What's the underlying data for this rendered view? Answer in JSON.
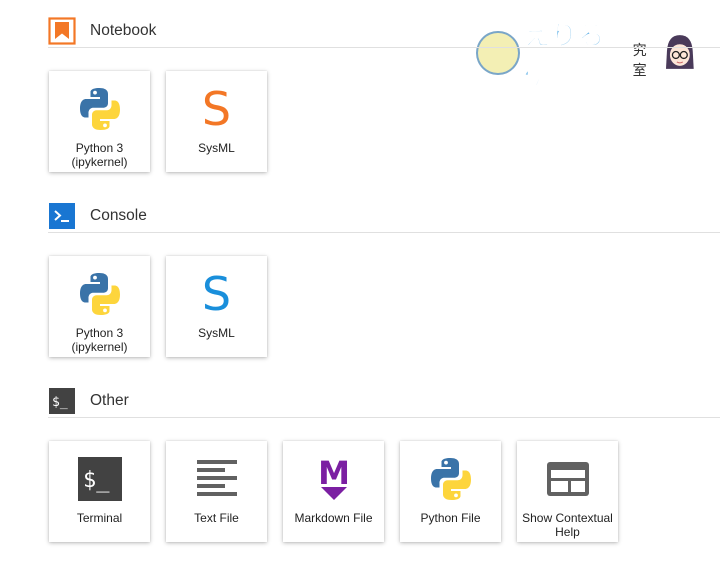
{
  "sections": {
    "notebook": {
      "title": "Notebook",
      "icon": "notebook-bookmark-icon",
      "accent": "#f37726",
      "cards": [
        {
          "label_line1": "Python 3",
          "label_line2": "(ipykernel)",
          "icon": "python-logo-icon"
        },
        {
          "label_line1": "SysML",
          "label_line2": "",
          "icon": "sysml-s-icon",
          "icon_text": "S",
          "icon_color": "#f37726"
        }
      ]
    },
    "console": {
      "title": "Console",
      "icon": "console-prompt-icon",
      "accent": "#1976d2",
      "cards": [
        {
          "label_line1": "Python 3",
          "label_line2": "(ipykernel)",
          "icon": "python-logo-icon"
        },
        {
          "label_line1": "SysML",
          "label_line2": "",
          "icon": "sysml-s-icon",
          "icon_text": "S",
          "icon_color": "#1a8fdb"
        }
      ]
    },
    "other": {
      "title": "Other",
      "icon": "terminal-dollar-icon",
      "accent": "#424242",
      "cards": [
        {
          "label_line1": "Terminal",
          "label_line2": "",
          "icon": "terminal-icon",
          "icon_text": "$_"
        },
        {
          "label_line1": "Text File",
          "label_line2": "",
          "icon": "text-file-icon"
        },
        {
          "label_line1": "Markdown File",
          "label_line2": "",
          "icon": "markdown-icon",
          "icon_text": "M"
        },
        {
          "label_line1": "Python File",
          "label_line2": "",
          "icon": "python-logo-icon"
        },
        {
          "label_line1": "Show Contextual",
          "label_line2": "Help",
          "icon": "contextual-help-icon"
        }
      ]
    }
  },
  "watermark": {
    "text": "えりる研",
    "sub": "究室"
  },
  "colors": {
    "python_blue": "#3a73a8",
    "python_yellow": "#fdd53c",
    "markdown_purple": "#7b1fa2",
    "icon_gray": "#616161"
  }
}
